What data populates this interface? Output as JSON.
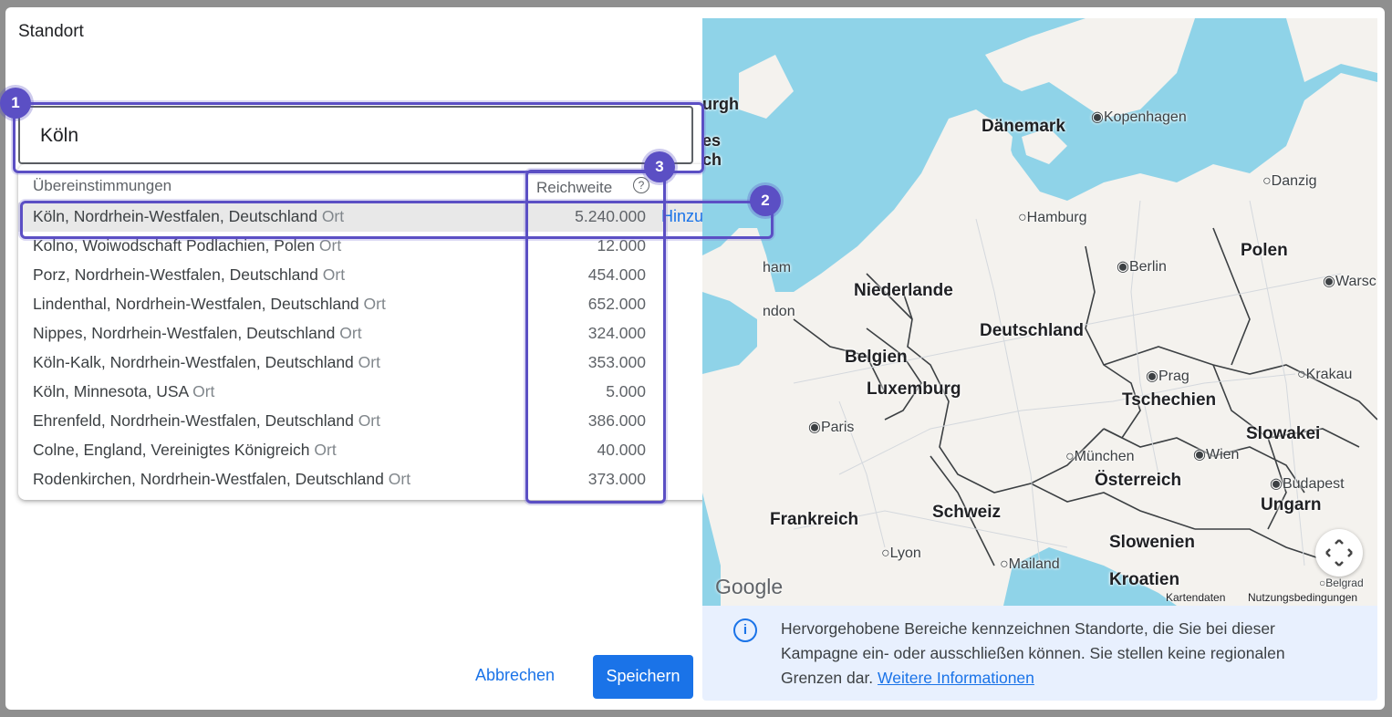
{
  "dialog": {
    "title": "Standort",
    "search": {
      "value": "Köln"
    },
    "dropdown": {
      "header_matches": "Übereinstimmungen",
      "header_reach": "Reichweite",
      "help_symbol": "?",
      "add_label": "Hinzufügen",
      "rows": [
        {
          "name": "Köln, Nordrhein-Westfalen, Deutschland",
          "type": "Ort",
          "reach": "5.240.000"
        },
        {
          "name": "Kolno, Woiwodschaft Podlachien, Polen",
          "type": "Ort",
          "reach": "12.000"
        },
        {
          "name": "Porz, Nordrhein-Westfalen, Deutschland",
          "type": "Ort",
          "reach": "454.000"
        },
        {
          "name": "Lindenthal, Nordrhein-Westfalen, Deutschland",
          "type": "Ort",
          "reach": "652.000"
        },
        {
          "name": "Nippes, Nordrhein-Westfalen, Deutschland",
          "type": "Ort",
          "reach": "324.000"
        },
        {
          "name": "Köln-Kalk, Nordrhein-Westfalen, Deutschland",
          "type": "Ort",
          "reach": "353.000"
        },
        {
          "name": "Köln, Minnesota, USA",
          "type": "Ort",
          "reach": "5.000"
        },
        {
          "name": "Ehrenfeld, Nordrhein-Westfalen, Deutschland",
          "type": "Ort",
          "reach": "386.000"
        },
        {
          "name": "Colne, England, Vereinigtes Königreich",
          "type": "Ort",
          "reach": "40.000"
        },
        {
          "name": "Rodenkirchen, Nordrhein-Westfalen, Deutschland",
          "type": "Ort",
          "reach": "373.000"
        }
      ]
    },
    "buttons": {
      "cancel": "Abbrechen",
      "save": "Speichern"
    }
  },
  "map": {
    "countries": [
      "Dänemark",
      "Polen",
      "Niederlande",
      "Deutschland",
      "Belgien",
      "Luxemburg",
      "Tschechien",
      "Slowakei",
      "Österreich",
      "Ungarn",
      "Frankreich",
      "Schweiz",
      "Slowenien",
      "Kroatien"
    ],
    "cities": [
      "Kopenhagen",
      "Danzig",
      "Hamburg",
      "Berlin",
      "Warsc",
      "Prag",
      "Krakau",
      "Paris",
      "München",
      "Wien",
      "Budapest",
      "Lyon",
      "Mailand",
      "Belgrad",
      "urgh",
      "es",
      "ch",
      "ham",
      "ndon"
    ],
    "attribution": "Google",
    "footer_data": "Kartendaten",
    "footer_terms": "Nutzungsbedingungen"
  },
  "info": {
    "icon": "i",
    "text": "Hervorgehobene Bereiche kennzeichnen Standorte, die Sie bei dieser Kampagne ein- oder ausschließen können. Sie stellen keine regionalen Grenzen dar.",
    "link": "Weitere Informationen"
  },
  "annotations": {
    "badge1": "1",
    "badge2": "2",
    "badge3": "3"
  },
  "colors": {
    "accent": "#1a73e8",
    "annotation": "#5b4fc4",
    "water": "#8fd3e8",
    "land": "#f4f2ee"
  }
}
